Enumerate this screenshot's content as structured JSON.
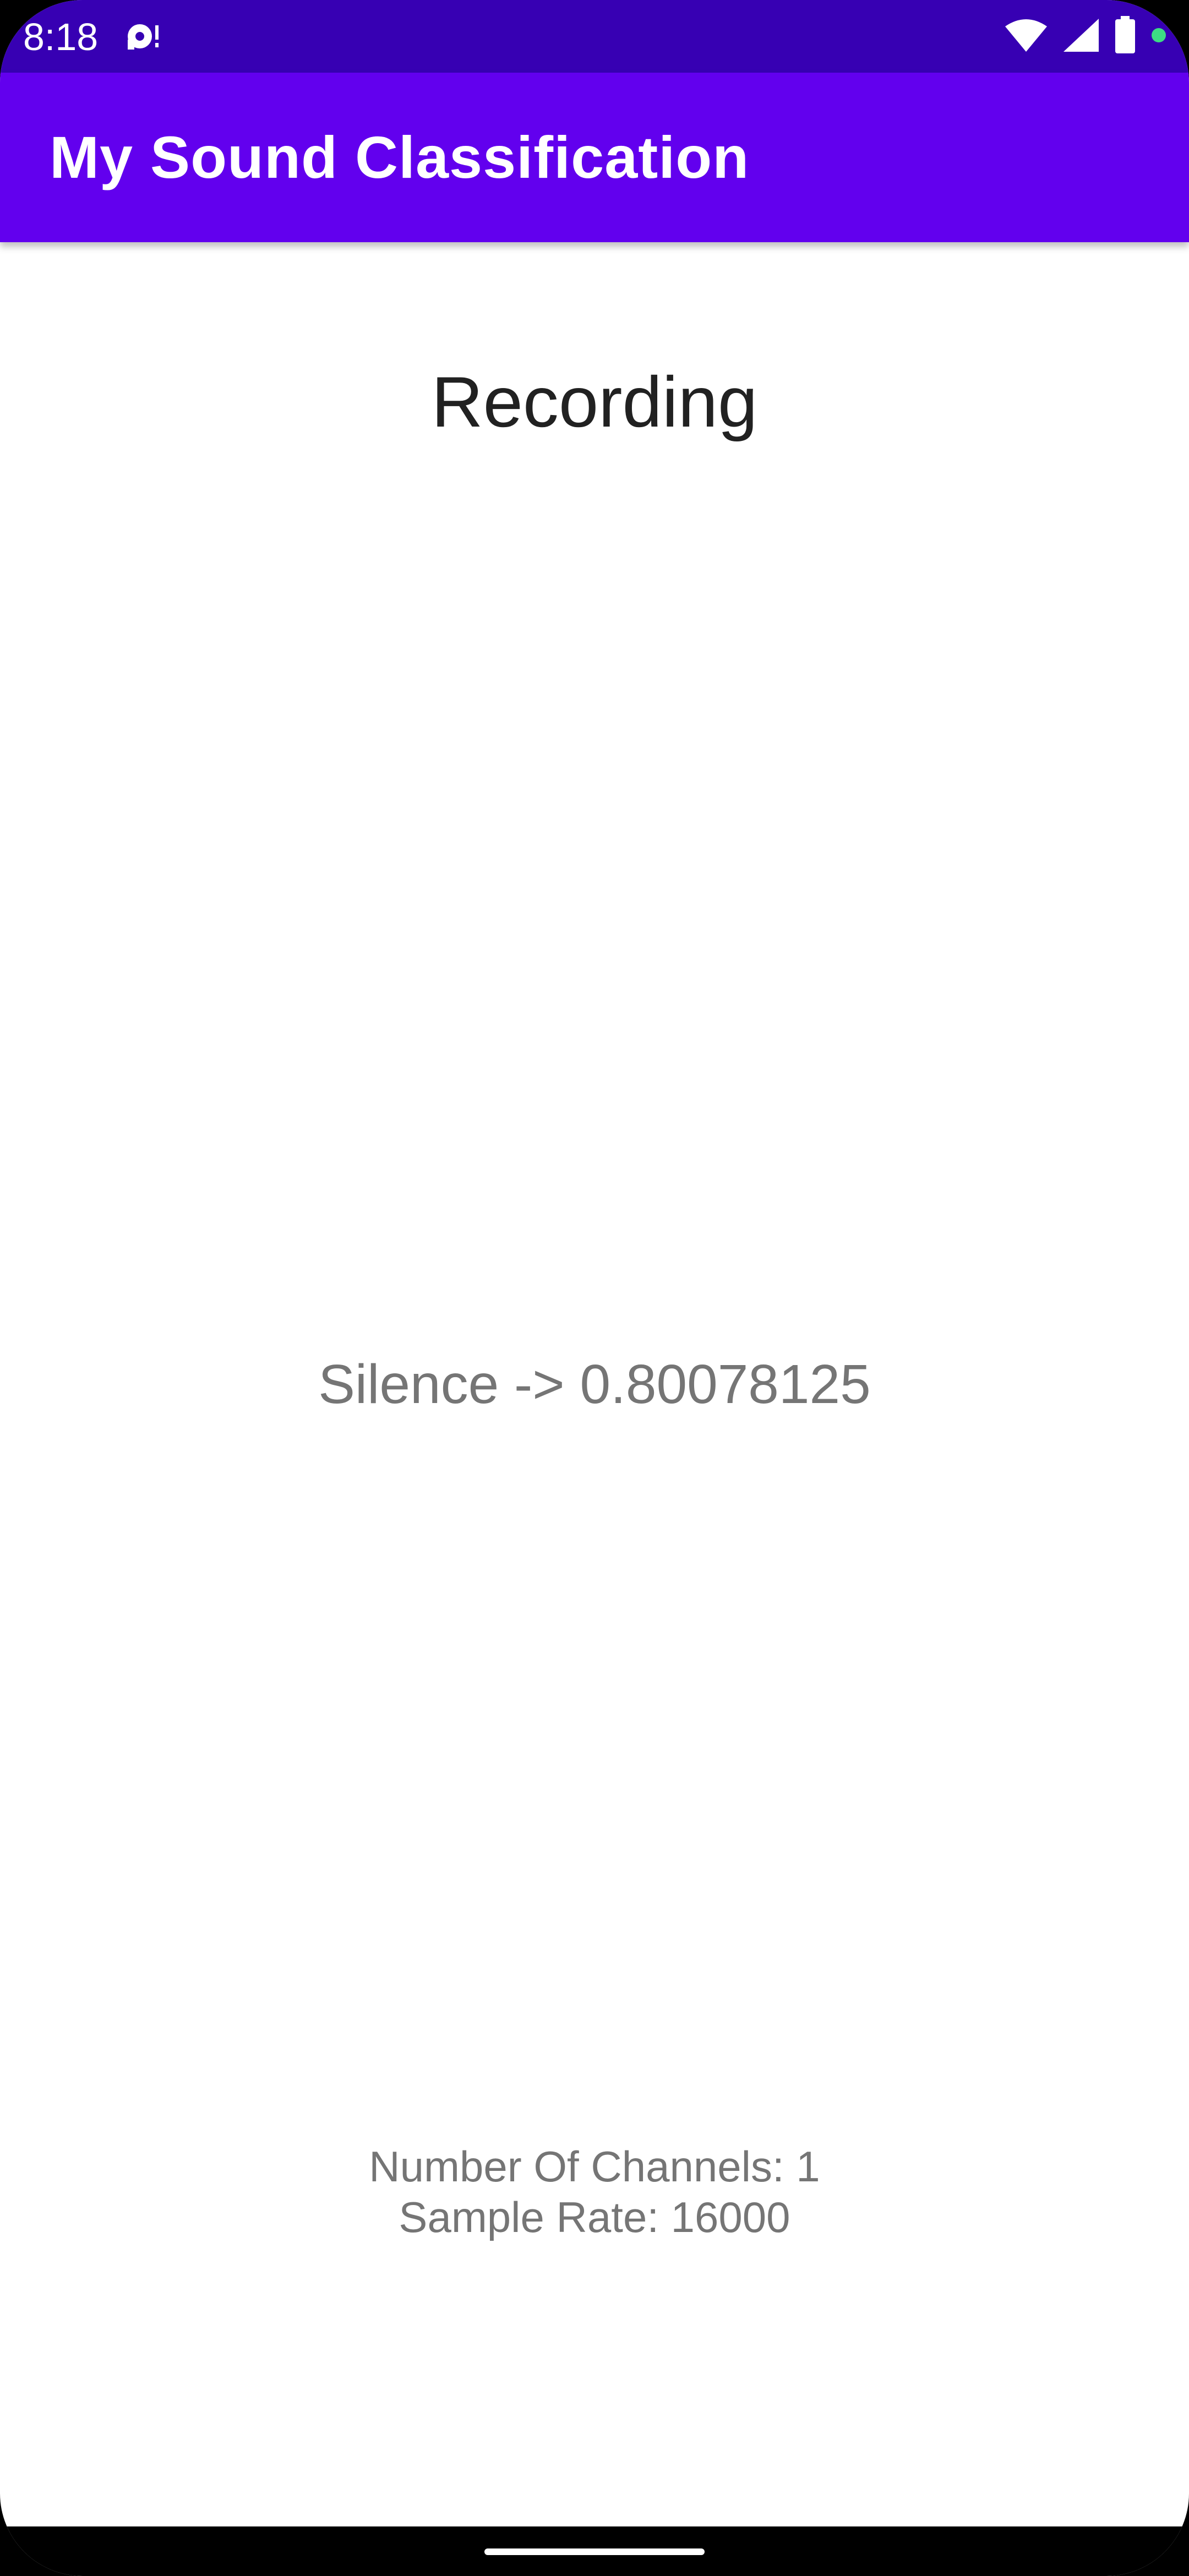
{
  "status_bar": {
    "time": "8:18",
    "notification_icon": "podcast-notification-icon",
    "icons": [
      "wifi-icon",
      "signal-icon",
      "battery-icon",
      "privacy-dot-icon"
    ],
    "background_color": "#3700b3",
    "privacy_dot_color": "#3ddc84"
  },
  "app_bar": {
    "title": "My Sound Classification",
    "background_color": "#6200ee"
  },
  "main": {
    "status_text": "Recording",
    "result_text": "Silence -> 0.80078125",
    "channels_text": "Number Of Channels: 1",
    "sample_rate_text": "Sample Rate: 16000"
  }
}
